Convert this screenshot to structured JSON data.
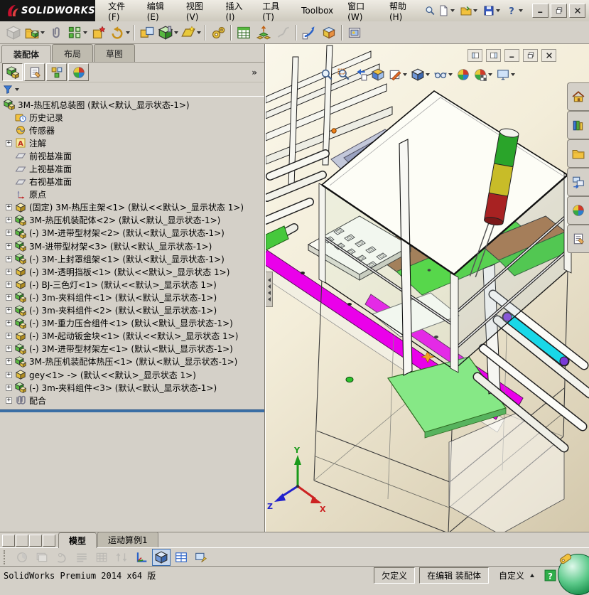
{
  "window": {
    "logo_text": "SOLIDWORKS",
    "menus": [
      {
        "label": "文件(F)"
      },
      {
        "label": "编辑(E)"
      },
      {
        "label": "视图(V)"
      },
      {
        "label": "插入(I)"
      },
      {
        "label": "工具(T)"
      },
      {
        "label": "Toolbox"
      },
      {
        "label": "窗口(W)"
      },
      {
        "label": "帮助(H)"
      }
    ],
    "search_icon": "search",
    "quick_icons": [
      {
        "icon": "new-doc",
        "dd": true
      },
      {
        "icon": "open-doc",
        "dd": true
      },
      {
        "icon": "save",
        "dd": true
      },
      {
        "icon": "help-q",
        "dd": true
      }
    ],
    "controls": [
      {
        "icon": "minimize"
      },
      {
        "icon": "restore"
      },
      {
        "icon": "close"
      }
    ]
  },
  "main_toolbar": {
    "items": [
      {
        "icon": "insert-component",
        "disabled": true
      },
      {
        "icon": "insert-components",
        "dd": true
      },
      {
        "icon": "mate"
      },
      {
        "icon": "linear-pattern",
        "dd": true
      },
      {
        "icon": "smart-fasteners"
      },
      {
        "icon": "move-component",
        "dd": true
      },
      {
        "sep": true
      },
      {
        "icon": "show-hidden"
      },
      {
        "icon": "assembly-features",
        "dd": true
      },
      {
        "icon": "reference-geometry",
        "dd": true
      },
      {
        "sep": true
      },
      {
        "icon": "motion-study"
      },
      {
        "sep": true
      },
      {
        "icon": "bom"
      },
      {
        "icon": "exploded-view"
      },
      {
        "icon": "explode-sketch",
        "disabled": true
      },
      {
        "sep": true
      },
      {
        "icon": "large-assembly"
      },
      {
        "icon": "interference"
      },
      {
        "sep": true
      },
      {
        "icon": "snapshot"
      }
    ]
  },
  "panel": {
    "tabs": [
      {
        "label": "装配体",
        "active": true
      },
      {
        "label": "布局"
      },
      {
        "label": "草图"
      }
    ],
    "fm_tabs": [
      {
        "icon": "assembly-tree",
        "pressed": true
      },
      {
        "icon": "properties"
      },
      {
        "icon": "configurations"
      },
      {
        "icon": "display-manager"
      }
    ],
    "overflow_label": "»",
    "filter": {
      "icon": "funnel",
      "dd": true
    }
  },
  "tree": {
    "items": [
      {
        "icon": "assembly-doc",
        "label": "3M-热压机总装图 (默认<默认_显示状态-1>)",
        "root": true
      },
      {
        "icon": "history",
        "label": "历史记录"
      },
      {
        "icon": "sensors",
        "label": "传感器"
      },
      {
        "icon": "annotations",
        "label": "注解",
        "expand": true
      },
      {
        "icon": "plane",
        "label": "前视基准面"
      },
      {
        "icon": "plane",
        "label": "上视基准面"
      },
      {
        "icon": "plane",
        "label": "右视基准面"
      },
      {
        "icon": "origin",
        "label": "原点"
      },
      {
        "icon": "part-comp",
        "label": "(固定) 3M-热压主架<1> (默认<<默认>_显示状态 1>)",
        "expand": true
      },
      {
        "icon": "assembly-comp",
        "label": "3M-热压机装配体<2> (默认<默认_显示状态-1>)",
        "expand": true
      },
      {
        "icon": "assembly-comp",
        "label": "(-) 3M-进带型材架<2> (默认<默认_显示状态-1>)",
        "expand": true
      },
      {
        "icon": "assembly-comp",
        "label": "3M-进带型材架<3> (默认<默认_显示状态-1>)",
        "expand": true
      },
      {
        "icon": "assembly-comp",
        "label": "(-) 3M-上封罩组架<1> (默认<默认_显示状态-1>)",
        "expand": true
      },
      {
        "icon": "part-comp",
        "label": "(-) 3M-透明挡板<1> (默认<<默认>_显示状态 1>)",
        "expand": true
      },
      {
        "icon": "part-comp",
        "label": "(-) BJ-三色灯<1> (默认<<默认>_显示状态 1>)",
        "expand": true
      },
      {
        "icon": "assembly-comp",
        "label": "(-) 3m-夹料组件<1> (默认<默认_显示状态-1>)",
        "expand": true
      },
      {
        "icon": "assembly-comp",
        "label": "(-) 3m-夹料组件<2> (默认<默认_显示状态-1>)",
        "expand": true
      },
      {
        "icon": "assembly-comp",
        "label": "(-) 3M-重力压合组件<1> (默认<默认_显示状态-1>)",
        "expand": true
      },
      {
        "icon": "part-comp",
        "label": "(-) 3M-起动钣金块<1> (默认<<默认>_显示状态 1>)",
        "expand": true
      },
      {
        "icon": "assembly-comp",
        "label": "(-) 3M-进带型材架左<1> (默认<默认_显示状态-1>)",
        "expand": true
      },
      {
        "icon": "assembly-comp",
        "label": "3M-热压机装配体热压<1> (默认<默认_显示状态-1>)",
        "expand": true
      },
      {
        "icon": "part-comp",
        "label": "gey<1> -> (默认<<默认>_显示状态 1>)",
        "expand": true
      },
      {
        "icon": "assembly-comp",
        "label": "(-) 3m-夹料组件<3> (默认<默认_显示状态-1>)",
        "expand": true
      },
      {
        "icon": "mates",
        "label": "配合",
        "expand": true
      }
    ]
  },
  "viewport": {
    "headsup": [
      {
        "icon": "zoom-fit"
      },
      {
        "icon": "zoom-area"
      },
      {
        "icon": "previous-view"
      },
      {
        "icon": "section-view"
      },
      {
        "icon": "view-orientation",
        "dd": true
      },
      {
        "icon": "display-style",
        "dd": true
      },
      {
        "icon": "hide-show",
        "dd": true
      },
      {
        "icon": "appearance"
      },
      {
        "icon": "scene",
        "dd": true
      },
      {
        "icon": "view-settings",
        "dd": true
      }
    ],
    "win_controls": [
      {
        "icon": "pane-left"
      },
      {
        "icon": "pane-right"
      },
      {
        "icon": "minimize"
      },
      {
        "icon": "restore"
      },
      {
        "icon": "close"
      }
    ],
    "taskpane": [
      {
        "icon": "home"
      },
      {
        "icon": "design-library"
      },
      {
        "icon": "file-explorer"
      },
      {
        "icon": "view-palette"
      },
      {
        "icon": "appearances"
      },
      {
        "icon": "custom-properties"
      }
    ],
    "triad": {
      "x": "X",
      "y": "Y",
      "z": "Z"
    }
  },
  "bottom": {
    "nav": [
      {
        "dir": "first"
      },
      {
        "dir": "prev"
      },
      {
        "dir": "next"
      },
      {
        "dir": "last"
      }
    ],
    "tabs": [
      {
        "label": "模型",
        "active": true
      },
      {
        "label": "运动算例1"
      }
    ],
    "motion_icons": [
      {
        "icon": "g-chart",
        "disabled": true
      },
      {
        "icon": "g-layers",
        "disabled": true
      },
      {
        "icon": "g-hand",
        "disabled": true
      },
      {
        "icon": "g-lines",
        "disabled": true
      },
      {
        "icon": "g-grid",
        "disabled": true
      },
      {
        "icon": "g-swap",
        "disabled": true
      },
      {
        "icon": "axes-chart"
      },
      {
        "icon": "display-style",
        "pressed": true
      },
      {
        "icon": "table-grid"
      },
      {
        "icon": "capture"
      }
    ]
  },
  "statusbar": {
    "left": "SolidWorks Premium 2014 x64 版",
    "state": "欠定义",
    "editing": "在编辑 装配体",
    "custom": "自定义"
  }
}
